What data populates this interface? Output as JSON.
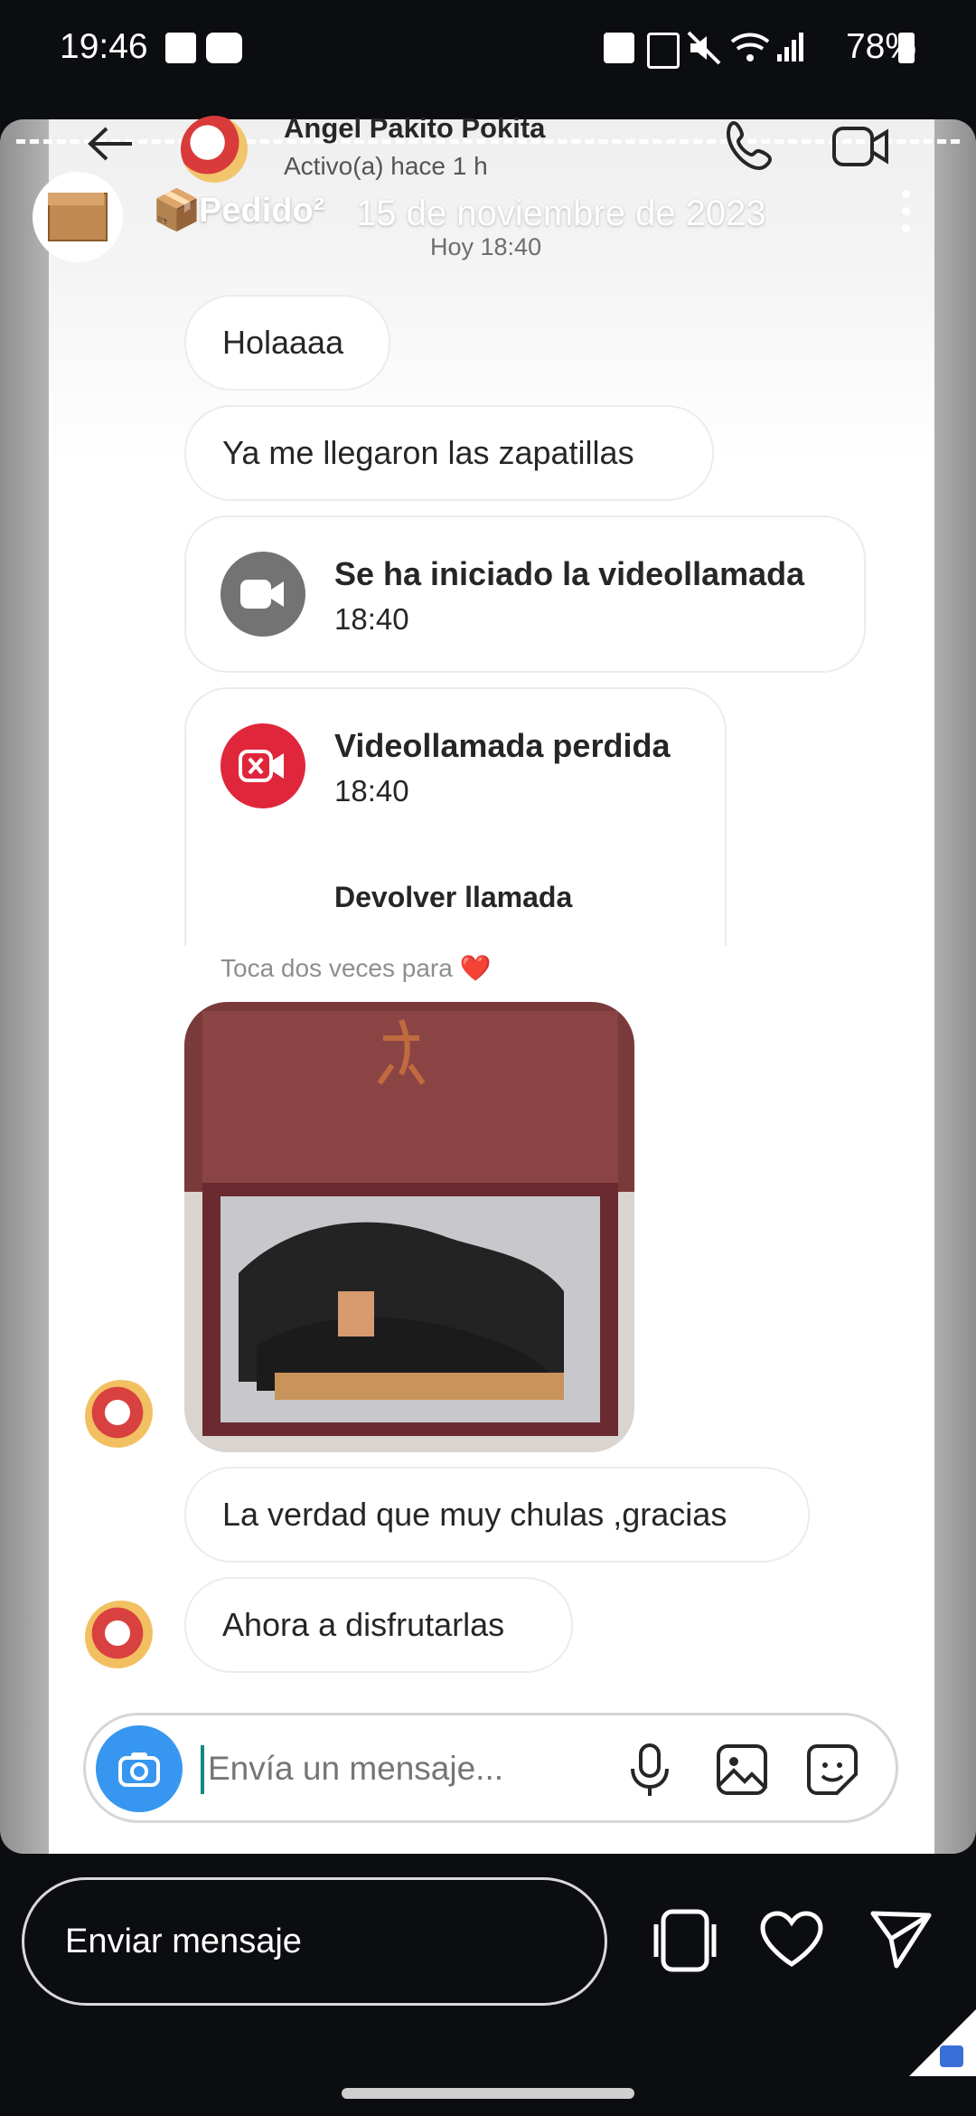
{
  "status_bar": {
    "time": "19:46",
    "battery": "78%"
  },
  "chat": {
    "contact_name": "Angel Pakito Pokita",
    "contact_status": "Activo(a) hace 1 h",
    "story_title": "Pedido²",
    "story_date": "15 de noviembre de 2023",
    "today_label": "Hoy 18:40",
    "messages": [
      {
        "text": "Holaaaa"
      },
      {
        "text": "Ya me llegaron las zapatillas"
      }
    ],
    "call_started": {
      "title": "Se ha iniciado la videollamada",
      "time": "18:40"
    },
    "call_missed": {
      "title": "Videollamada perdida",
      "time": "18:40",
      "action": "Devolver llamada"
    },
    "double_tap_hint": "Toca dos veces para ❤️",
    "incoming": [
      {
        "text": "La verdad que muy chulas ,gracias"
      },
      {
        "text": "Ahora a disfrutarlas"
      }
    ],
    "composer_placeholder": "Envía un mensaje..."
  },
  "reply_bar": {
    "placeholder": "Enviar mensaje"
  },
  "colors": {
    "accent_blue": "#3797f0",
    "missed_red": "#e0263b",
    "neutral_gray": "#737373"
  }
}
